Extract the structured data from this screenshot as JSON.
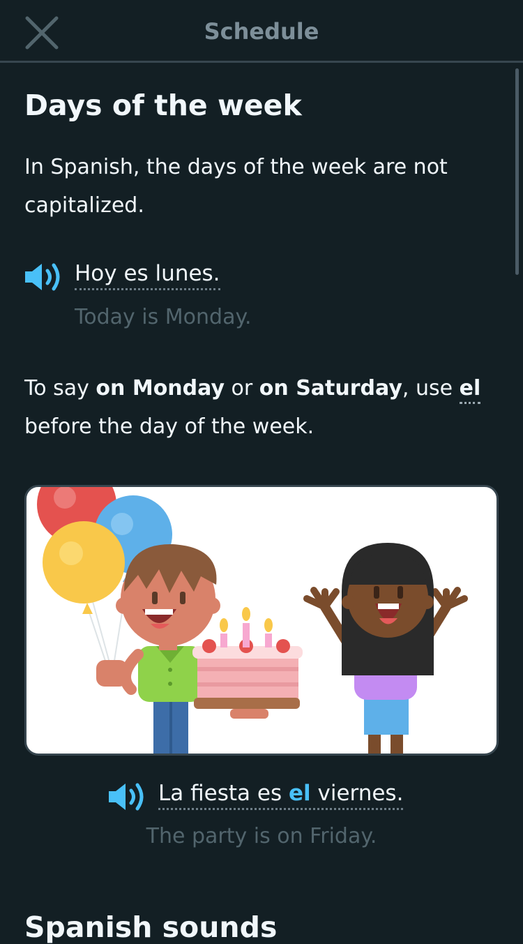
{
  "header": {
    "title": "Schedule",
    "close_icon": "close-icon"
  },
  "lesson": {
    "heading": "Days of the week",
    "intro": "In Spanish, the days of the week are not capitalized.",
    "example1": {
      "spanish": "Hoy es lunes.",
      "english": "Today is Monday.",
      "icon": "speaker-icon"
    },
    "rule": {
      "part1": "To say ",
      "bold1": "on Monday",
      "part2": " or ",
      "bold2": "on Saturday",
      "part3": ", use ",
      "word": "el",
      "part4": " before the day of the week."
    },
    "illustration": {
      "description_icon": "birthday-party-illustration"
    },
    "example2": {
      "part1": "La fiesta es ",
      "highlight": "el",
      "part2": " viernes.",
      "english": "The party is on Friday.",
      "icon": "speaker-icon"
    },
    "next_heading": "Spanish sounds"
  },
  "colors": {
    "background": "#131f24",
    "text": "#f1f7fb",
    "muted": "#52656d",
    "accent_blue": "#49c0f8",
    "divider": "#37464f"
  }
}
